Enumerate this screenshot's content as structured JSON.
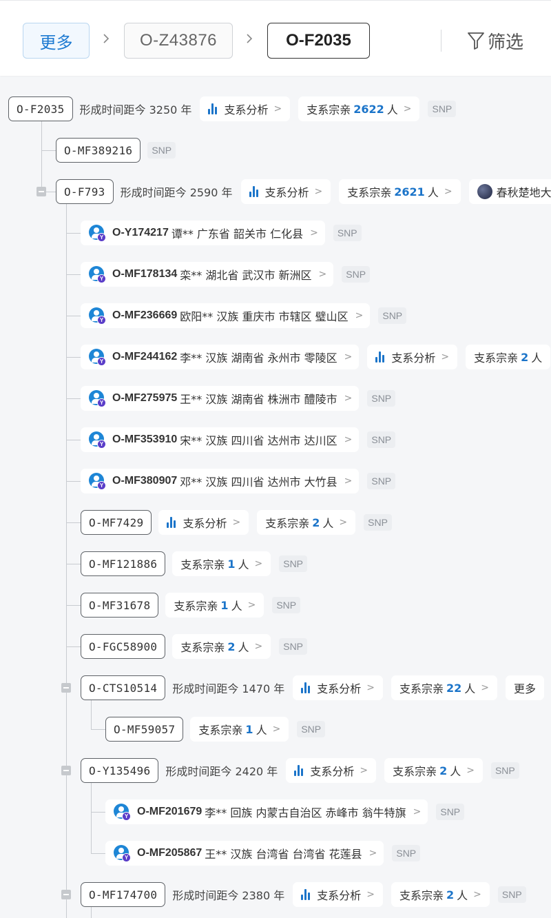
{
  "header": {
    "more_label": "更多",
    "parent_code": "O-Z43876",
    "current_code": "O-F2035",
    "filter_label": "筛选"
  },
  "colors": {
    "accent": "#1b74c9",
    "snp_bg": "#eceef1",
    "page_bg": "#f5f6f8"
  },
  "labels": {
    "analysis": "支系分析",
    "relatives_prefix": "支系宗亲",
    "relatives_suffix": "人",
    "snp": "SNP",
    "more": "更多"
  },
  "tree": {
    "root": {
      "code": "O-F2035",
      "time": "形成时间距今 3250 年",
      "relatives": "2622"
    },
    "n1": {
      "code": "O-MF389216"
    },
    "n2": {
      "code": "O-F793",
      "time": "形成时间距今 2590 年",
      "relatives": "2621",
      "period": "春秋楚地大"
    },
    "users": [
      {
        "id": "O-Y174217",
        "info": "谭** 广东省 韶关市 仁化县"
      },
      {
        "id": "O-MF178134",
        "info": "栾** 湖北省 武汉市 新洲区"
      },
      {
        "id": "O-MF236669",
        "info": "欧阳** 汉族 重庆市 市辖区 璧山区"
      },
      {
        "id": "O-MF244162",
        "info": "李** 汉族 湖南省 永州市 零陵区",
        "relatives": "2"
      },
      {
        "id": "O-MF275975",
        "info": "王** 汉族 湖南省 株洲市 醴陵市"
      },
      {
        "id": "O-MF353910",
        "info": "宋** 汉族 四川省 达州市 达川区"
      },
      {
        "id": "O-MF380907",
        "info": "邓** 汉族 四川省 达州市 大竹县"
      }
    ],
    "n3": {
      "code": "O-MF7429",
      "relatives": "2"
    },
    "n4": {
      "code": "O-MF121886",
      "relatives": "1"
    },
    "n5": {
      "code": "O-MF31678",
      "relatives": "1"
    },
    "n6": {
      "code": "O-FGC58900",
      "relatives": "2"
    },
    "n7": {
      "code": "O-CTS10514",
      "time": "形成时间距今 1470 年",
      "relatives": "22"
    },
    "n7a": {
      "code": "O-MF59057",
      "relatives": "1"
    },
    "n8": {
      "code": "O-Y135496",
      "time": "形成时间距今 2420 年",
      "relatives": "2"
    },
    "n8u": [
      {
        "id": "O-MF201679",
        "info": "李** 回族 内蒙古自治区 赤峰市 翁牛特旗"
      },
      {
        "id": "O-MF205867",
        "info": "王** 汉族 台湾省 台湾省 花莲县"
      }
    ],
    "n9": {
      "code": "O-MF174700",
      "time": "形成时间距今 2380 年",
      "relatives": "2"
    }
  }
}
